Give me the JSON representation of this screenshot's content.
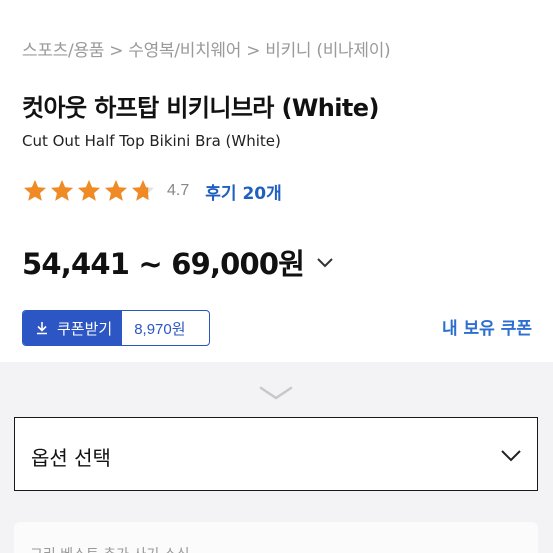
{
  "breadcrumb": "스포츠/용품 > 수영복/비치웨어 > 비키니 (비나제이)",
  "product": {
    "title": "컷아웃 하프탑 비키니브라 (White)",
    "subtitle": "Cut Out Half Top Bikini Bra (White)"
  },
  "rating": {
    "value": "4.7",
    "stars_filled": 4.7,
    "stars_total": 5,
    "review_link": "후기 20개"
  },
  "price": {
    "range": "54,441 ~ 69,000원"
  },
  "coupon": {
    "button_label": "쿠폰받기",
    "amount": "8,970원",
    "my_coupon_link": "내 보유 쿠폰"
  },
  "options": {
    "select_label": "옵션 선택"
  },
  "bottom_panel": {
    "text": "그리 베스트 추가 사기 소식"
  },
  "colors": {
    "star": "#f08a24",
    "accent_blue": "#2c56c3",
    "link_blue": "#1f5fbf",
    "background_gray": "#f3f3f5"
  },
  "icons": [
    "star-icon",
    "chevron-down-icon",
    "download-icon",
    "expand-chevron-icon",
    "option-chevron-icon"
  ]
}
